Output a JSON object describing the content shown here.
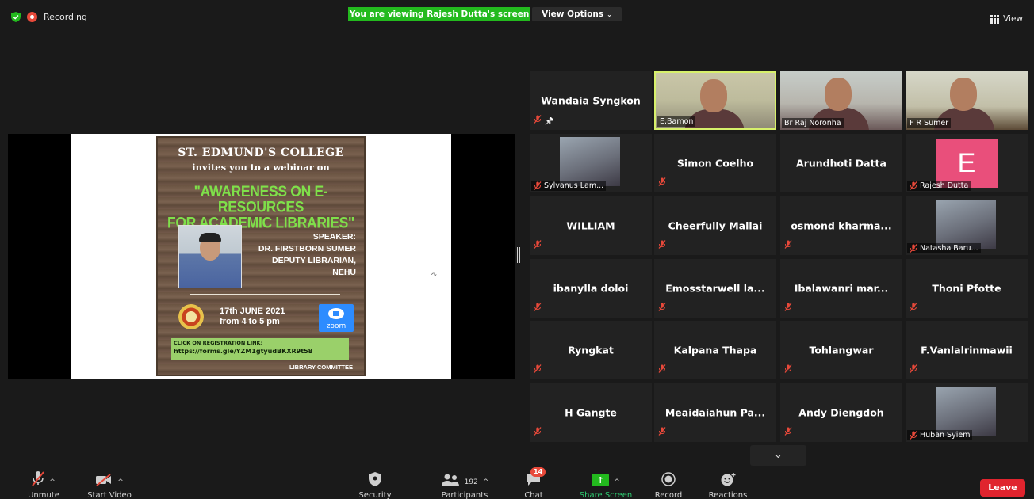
{
  "top": {
    "recording_label": "Recording",
    "viewing_banner": "You are viewing Rajesh Dutta's screen",
    "view_options": "View Options",
    "view_label": "View"
  },
  "poster": {
    "college": "ST. EDMUND'S COLLEGE",
    "invite": "invites you to a webinar on",
    "title_line1": "\"AWARENESS ON E-RESOURCES",
    "title_line2": "FOR ACADEMIC LIBRARIES\"",
    "speaker_heading": "SPEAKER:",
    "speaker_name": "DR. FIRSTBORN SUMER",
    "speaker_role": "DEPUTY LIBRARIAN,",
    "speaker_org": "NEHU",
    "date": "17th JUNE 2021",
    "time": "from 4 to 5 pm",
    "zoom_word": "zoom",
    "reg_heading": "CLICK ON REGISTRATION LINK:",
    "reg_link": "https://forms.gle/YZM1gtyudBKXR9t58",
    "committee": "LIBRARY COMMITTEE"
  },
  "participants": [
    {
      "name": "Wandaia Syngkon",
      "kind": "name",
      "muted": true,
      "pinned": true
    },
    {
      "name": "E.Bamon",
      "kind": "video",
      "muted": false,
      "active": true
    },
    {
      "name": "Br Raj Noronha",
      "kind": "video",
      "muted": false
    },
    {
      "name": "F R Sumer",
      "kind": "video",
      "muted": false
    },
    {
      "name": "Sylvanus Lam...",
      "kind": "photo",
      "muted": true
    },
    {
      "name": "Simon Coelho",
      "kind": "name",
      "muted": true
    },
    {
      "name": "Arundhoti Datta",
      "kind": "name",
      "muted": false
    },
    {
      "name": "Rajesh Dutta",
      "kind": "avatar",
      "initial": "E",
      "muted": true
    },
    {
      "name": "WILLIAM",
      "kind": "name",
      "muted": true
    },
    {
      "name": "Cheerfully Mallai",
      "kind": "name",
      "muted": true
    },
    {
      "name": "osmond kharma...",
      "kind": "name",
      "muted": true
    },
    {
      "name": "Natasha Baru...",
      "kind": "photo",
      "muted": true
    },
    {
      "name": "ibanylla doloi",
      "kind": "name",
      "muted": true
    },
    {
      "name": "Emosstarwell la...",
      "kind": "name",
      "muted": true
    },
    {
      "name": "Ibalawanri mar...",
      "kind": "name",
      "muted": true
    },
    {
      "name": "Thoni Pfotte",
      "kind": "name",
      "muted": true
    },
    {
      "name": "Ryngkat",
      "kind": "name",
      "muted": true
    },
    {
      "name": "Kalpana Thapa",
      "kind": "name",
      "muted": true
    },
    {
      "name": "Tohlangwar",
      "kind": "name",
      "muted": true
    },
    {
      "name": "F.Vanlalrinmawii",
      "kind": "name",
      "muted": true
    },
    {
      "name": "H Gangte",
      "kind": "name",
      "muted": true
    },
    {
      "name": "Meaidaiahun Pa...",
      "kind": "name",
      "muted": true
    },
    {
      "name": "Andy Diengdoh",
      "kind": "name",
      "muted": true
    },
    {
      "name": "Huban Syiem",
      "kind": "photo",
      "muted": true
    }
  ],
  "toolbar": {
    "unmute": "Unmute",
    "start_video": "Start Video",
    "security": "Security",
    "participants": "Participants",
    "participants_count": "192",
    "chat": "Chat",
    "chat_badge": "14",
    "share_screen": "Share Screen",
    "record": "Record",
    "reactions": "Reactions",
    "leave": "Leave"
  },
  "colors": {
    "viewing_banner": "#23ba1e",
    "active_speaker_border": "#d7f06b",
    "leave_button": "#e0242e",
    "muted_mic": "#e8493a",
    "avatar_bg": "#e94f7b"
  }
}
